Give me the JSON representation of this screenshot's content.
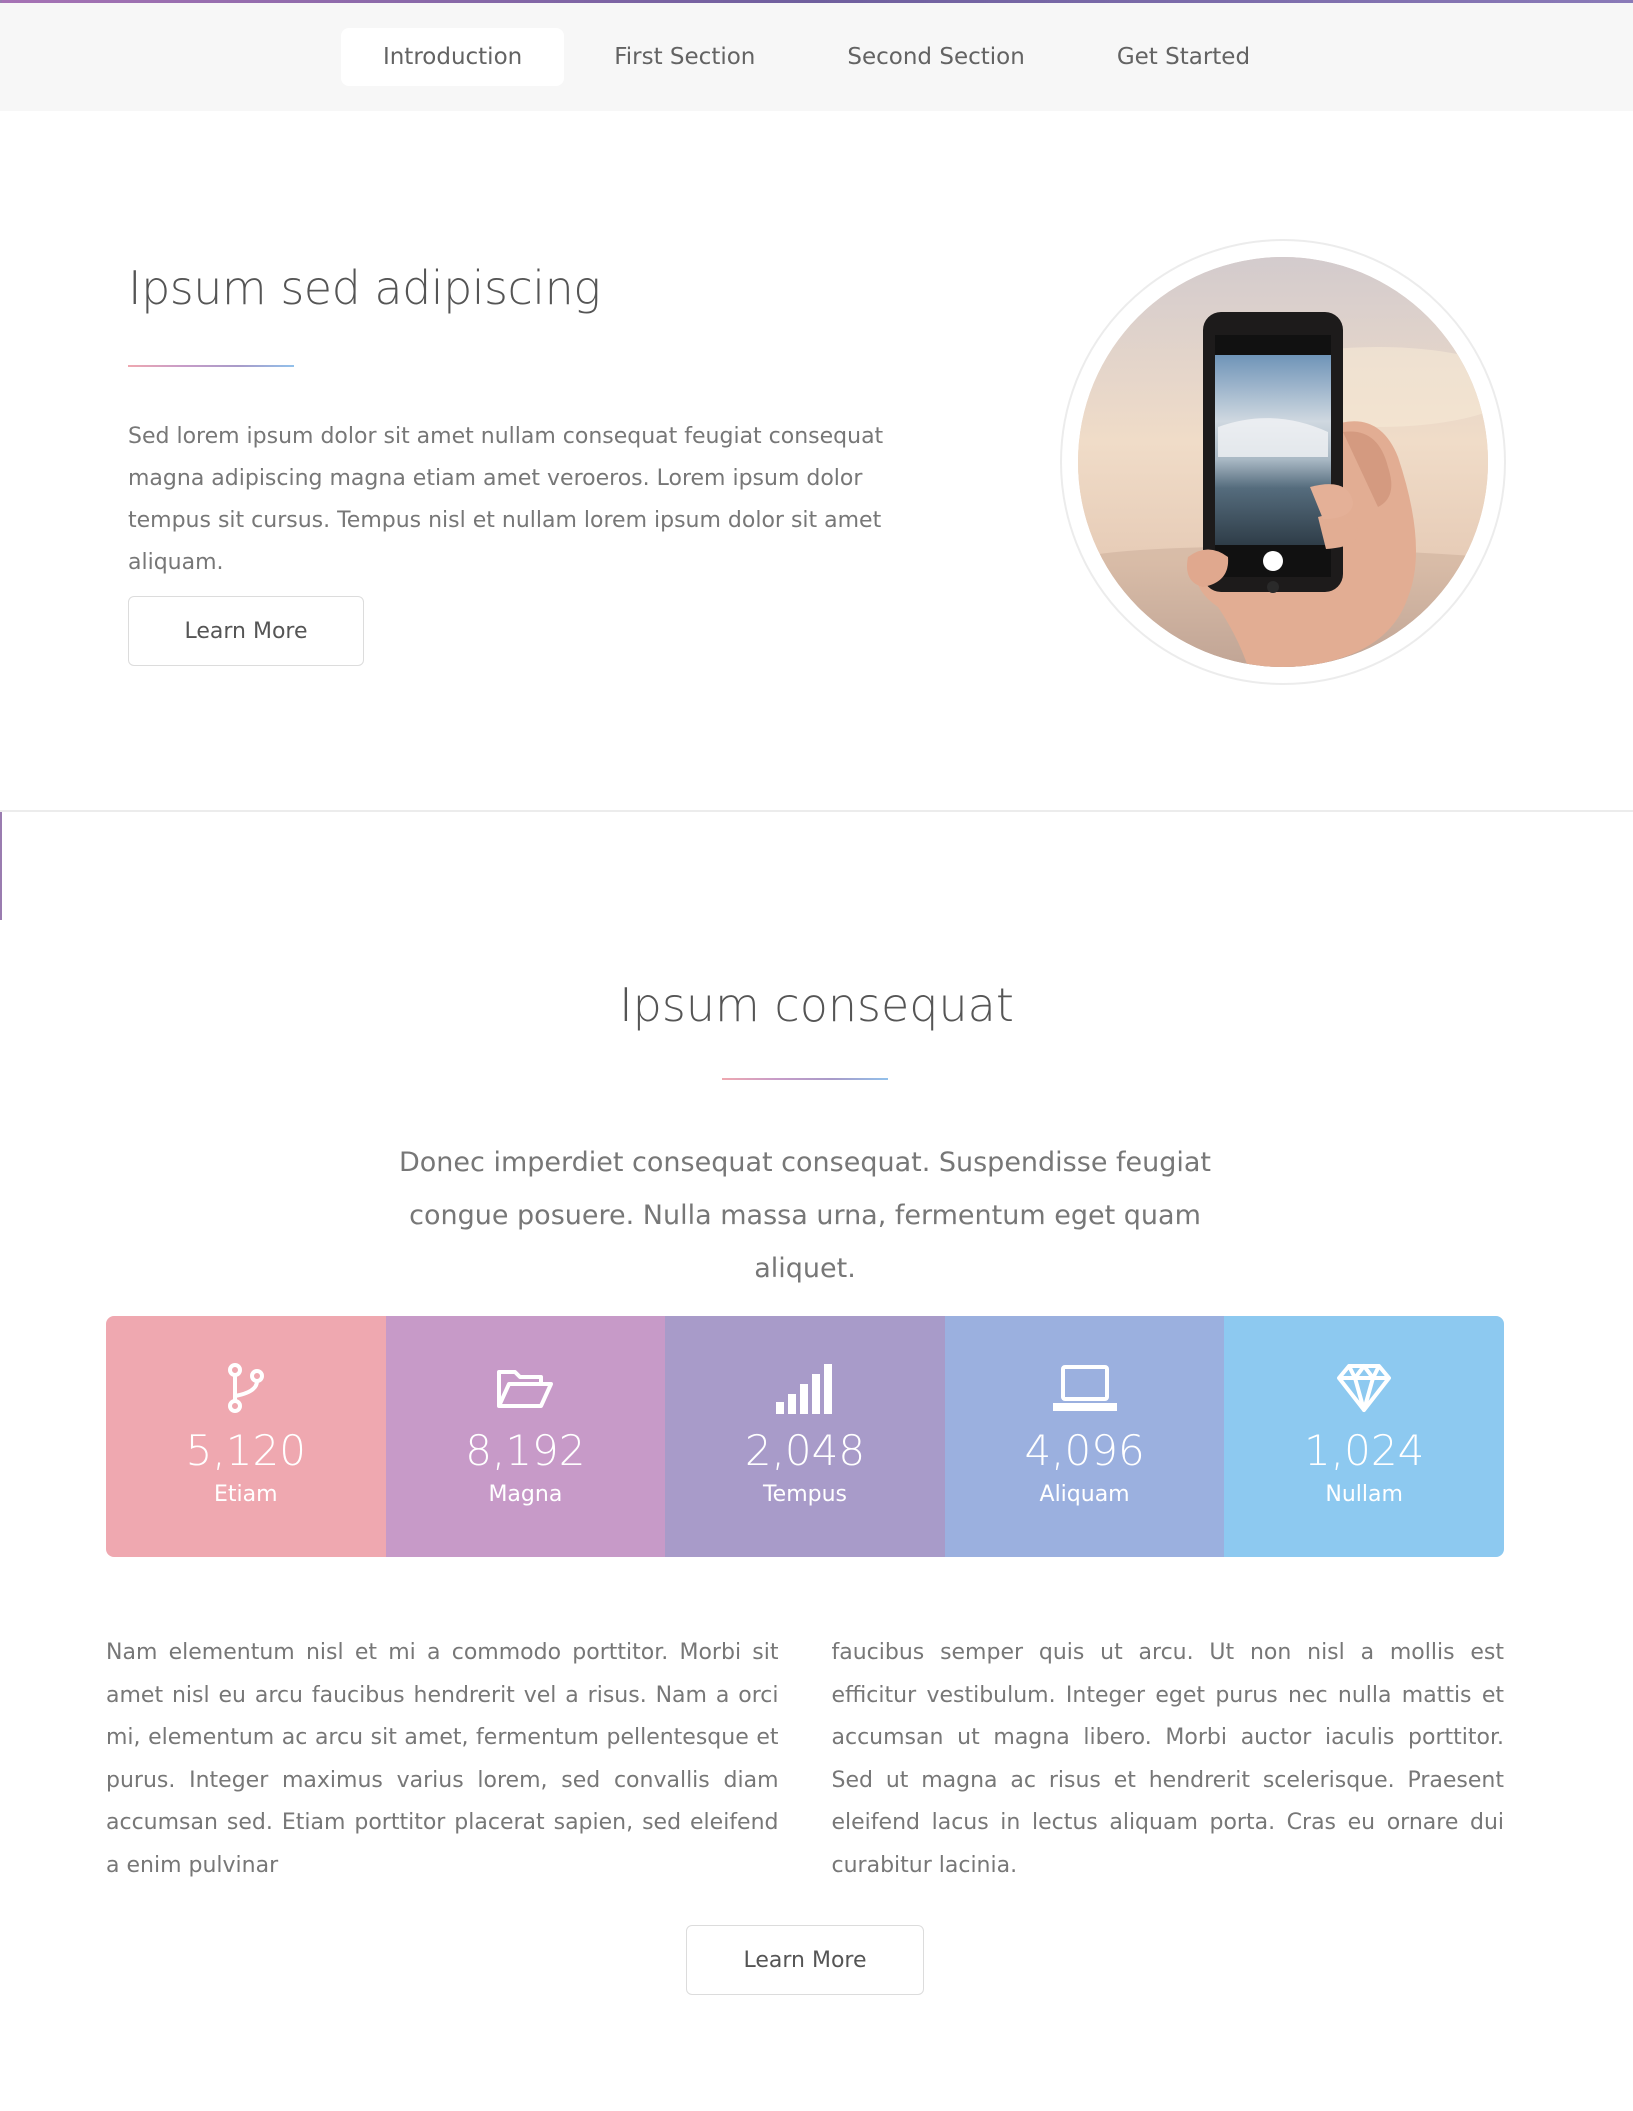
{
  "nav": {
    "items": [
      {
        "label": "Introduction",
        "active": true
      },
      {
        "label": "First Section",
        "active": false
      },
      {
        "label": "Second Section",
        "active": false
      },
      {
        "label": "Get Started",
        "active": false
      }
    ]
  },
  "intro": {
    "title": "Ipsum sed adipiscing",
    "text": "Sed lorem ipsum dolor sit amet nullam consequat feugiat consequat magna adipiscing magna etiam amet veroeros. Lorem ipsum dolor tempus sit cursus. Tempus nisl et nullam lorem ipsum dolor sit amet aliquam.",
    "button_label": "Learn More",
    "image_icon": "phone-photo-image"
  },
  "section2": {
    "title": "Ipsum consequat",
    "lead": "Donec imperdiet consequat consequat. Suspendisse feugiat congue posuere. Nulla massa urna, fermentum eget quam aliquet.",
    "stats": [
      {
        "icon": "code-fork-icon",
        "value": "5,120",
        "label": "Etiam",
        "color": "#efa8b0"
      },
      {
        "icon": "folder-open-icon",
        "value": "8,192",
        "label": "Magna",
        "color": "#c79ac8"
      },
      {
        "icon": "signal-icon",
        "value": "2,048",
        "label": "Tempus",
        "color": "#a89bc9"
      },
      {
        "icon": "laptop-icon",
        "value": "4,096",
        "label": "Aliquam",
        "color": "#9bb0df"
      },
      {
        "icon": "diamond-icon",
        "value": "1,024",
        "label": "Nullam",
        "color": "#8dc9f0"
      }
    ],
    "body_text": "Nam elementum nisl et mi a commodo porttitor. Morbi sit amet nisl eu arcu faucibus hendrerit vel a risus. Nam a orci mi, elementum ac arcu sit amet, fermentum pellentesque et purus. Integer maximus varius lorem, sed convallis diam accumsan sed. Etiam porttitor placerat sapien, sed eleifend a enim pulvinar faucibus semper quis ut arcu. Ut non nisl a mollis est efficitur vestibulum. Integer eget purus nec nulla mattis et accumsan ut magna libero. Morbi auctor iaculis porttitor. Sed ut magna ac risus et hendrerit scelerisque. Praesent eleifend lacus in lectus aliquam porta. Cras eu ornare dui curabitur lacinia.",
    "col1": "Nam elementum nisl et mi a commodo porttitor. Morbi sit amet nisl eu arcu faucibus hendrerit vel a risus. Nam a orci mi, elementum ac arcu sit amet, fermentum pellentesque et purus. Integer maximus varius lorem, sed convallis diam accumsan sed. Etiam porttitor placerat sapien, sed eleifend a enim pulvinar",
    "col2": "faucibus semper quis ut arcu. Ut non nisl a mollis est efficitur vestibulum. Integer eget purus nec nulla mattis et accumsan ut magna libero. Morbi auctor iaculis porttitor. Sed ut magna ac risus et hendrerit scelerisque. Praesent eleifend lacus in lectus aliquam porta. Cras eu ornare dui curabitur lacinia.",
    "button_label": "Learn More"
  }
}
